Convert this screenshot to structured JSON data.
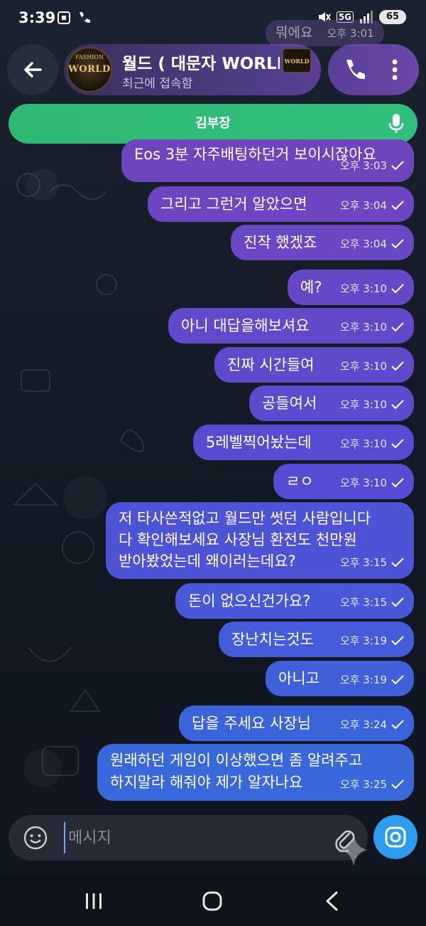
{
  "status_bar": {
    "time": "3:39",
    "network_badge": "5G",
    "battery": "65"
  },
  "header": {
    "title": "월드 ( 대문자 WORLD",
    "subtitle": "최근에 접속함",
    "avatar_text": "WORLD",
    "avatar_top_text": "FASHION",
    "logo_text": "WORLD"
  },
  "banner": {
    "label": "김부장"
  },
  "ghost_messages": [
    {
      "text": "뭐에요",
      "time": "오후 3:01"
    }
  ],
  "messages": [
    {
      "text": "Eos 3분 자주배팅하던거 보이시잖아요",
      "time": "오후 3:03",
      "color": "#6e45bd"
    },
    {
      "text": "그리고 그런거 알았으면",
      "time": "오후 3:04",
      "color": "#6c46c0"
    },
    {
      "text": "진작 했겠죠",
      "time": "오후 3:04",
      "color": "#6a47c3"
    },
    {
      "text": "예?",
      "time": "오후 3:10",
      "color": "#6648c7"
    },
    {
      "text": "아니 대답을해보셔요",
      "time": "오후 3:10",
      "color": "#6249ca"
    },
    {
      "text": "진짜 시간들여",
      "time": "오후 3:10",
      "color": "#5f4acc"
    },
    {
      "text": "공들여서",
      "time": "오후 3:10",
      "color": "#5b4bce"
    },
    {
      "text": "5레벨찍어놨는데",
      "time": "오후 3:10",
      "color": "#574cd1"
    },
    {
      "text": "ㄹㅇ",
      "time": "오후 3:10",
      "color": "#544dd3"
    },
    {
      "lines": [
        "저 타사쓴적없고 월드만 썻던 사람입니다",
        "다 확인해보세요 사장님 환전도 천만원",
        "받아봤었는데 왜이러는데요?"
      ],
      "time": "오후 3:15",
      "color": "#4e53d6"
    },
    {
      "text": "돈이 없으신건가요?",
      "time": "오후 3:15",
      "color": "#4858d8"
    },
    {
      "text": "장난치는것도",
      "time": "오후 3:19",
      "color": "#445cd9"
    },
    {
      "text": "아니고",
      "time": "오후 3:19",
      "color": "#4060da"
    },
    {
      "text": "답을 주세요 사장님",
      "time": "오후 3:24",
      "color": "#3c64da"
    },
    {
      "lines": [
        "원래하던 게임이 이상했으면 좀 알려주고",
        "하지말라 해줘야 제가 알자나요"
      ],
      "time": "오후 3:25",
      "color": "#3868d9"
    }
  ],
  "input": {
    "placeholder": "메시지",
    "value": ""
  },
  "colors": {
    "banner": "#31c07c",
    "camera_button": "#2d9cf0",
    "header_pill": "#4c3b7e"
  }
}
